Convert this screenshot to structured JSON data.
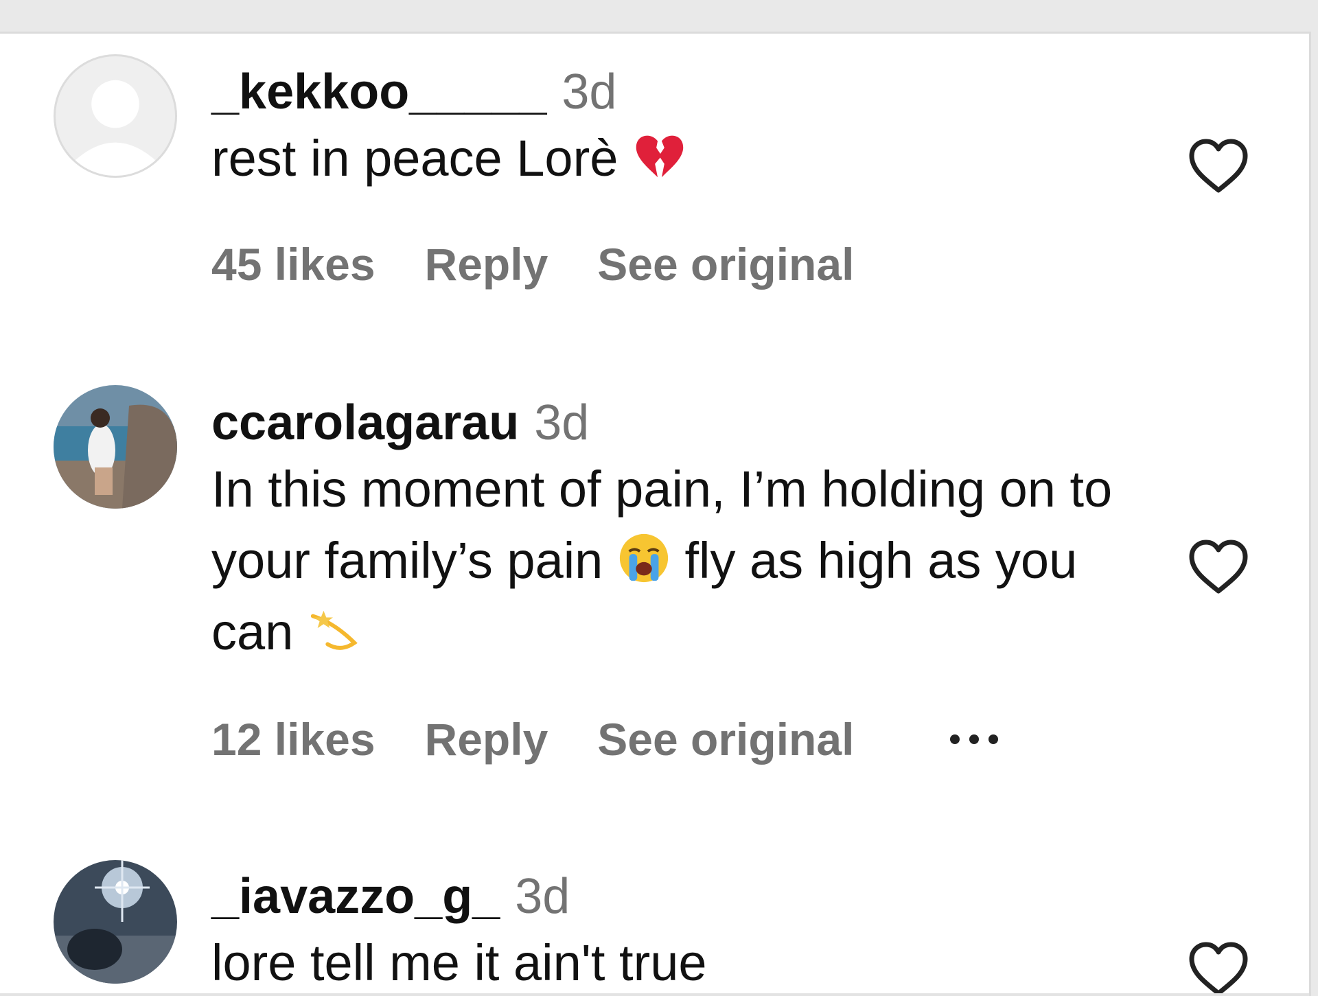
{
  "comments": [
    {
      "username": "_kekkoo_____",
      "time": "3d",
      "text_parts": [
        "rest in peace Lorè"
      ],
      "emojis": [
        "broken-heart"
      ],
      "likes": "45 likes",
      "reply_label": "Reply",
      "see_original_label": "See original",
      "avatar": "default-avatar"
    },
    {
      "username": "ccarolagarau",
      "time": "3d",
      "text_parts": [
        "In this moment of pain, I’m holding on to your family’s pain",
        "fly as high as you can"
      ],
      "emojis": [
        "loudly-crying-face",
        "dizzy-star"
      ],
      "likes": "12 likes",
      "reply_label": "Reply",
      "see_original_label": "See original",
      "avatar": "photo-avatar"
    },
    {
      "username": "_iavazzo_g_",
      "time": "3d",
      "text_parts": [
        "lore tell me it ain't true"
      ],
      "avatar": "photo-avatar"
    }
  ],
  "icons": {
    "like": "heart-outline-icon",
    "more": "more-options-icon"
  },
  "colors": {
    "text": "#111111",
    "muted": "#737373",
    "divider": "#dbdbdb"
  }
}
